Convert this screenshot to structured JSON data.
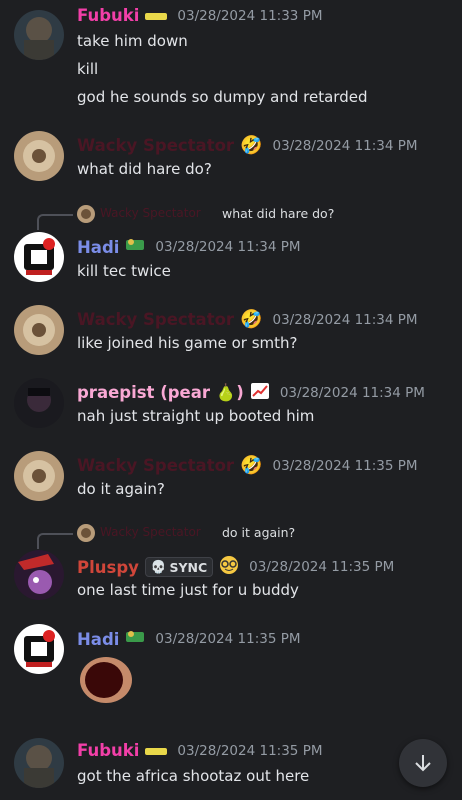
{
  "messages": [
    {
      "user": "Fubuki",
      "user_color": "#f23fa8",
      "timestamp": "03/28/2024 11:33 PM",
      "lines": [
        "take him down",
        "kill",
        "god he sounds so dumpy and retarded"
      ]
    },
    {
      "user": "Wacky Spectator",
      "user_color": "#4a1624",
      "timestamp": "03/28/2024 11:34 PM",
      "lines": [
        "what did hare do?"
      ]
    },
    {
      "reply_to_user": "Wacky Spectator",
      "reply_to_text": "what did hare do?",
      "user": "Hadi",
      "user_color": "#7b8de8",
      "timestamp": "03/28/2024 11:34 PM",
      "lines": [
        "kill tec twice"
      ]
    },
    {
      "user": "Wacky Spectator",
      "user_color": "#4a1624",
      "timestamp": "03/28/2024 11:34 PM",
      "lines": [
        "like joined his game or smth?"
      ]
    },
    {
      "user": "praepist (pear 🍐)",
      "user_color": "#f9a8d4",
      "timestamp": "03/28/2024 11:34 PM",
      "lines": [
        "nah just straight up booted him"
      ]
    },
    {
      "user": "Wacky Spectator",
      "user_color": "#4a1624",
      "timestamp": "03/28/2024 11:35 PM",
      "lines": [
        "do it again?"
      ]
    },
    {
      "reply_to_user": "Wacky Spectator",
      "reply_to_text": "do it again?",
      "user": "Pluspy",
      "user_color": "#d0463a",
      "tag": "SYNC",
      "timestamp": "03/28/2024 11:35 PM",
      "lines": [
        "one last time just for u buddy"
      ]
    },
    {
      "user": "Hadi",
      "user_color": "#7b8de8",
      "timestamp": "03/28/2024 11:35 PM",
      "lines": []
    },
    {
      "user": "Fubuki",
      "user_color": "#f23fa8",
      "timestamp": "03/28/2024 11:35 PM",
      "lines": [
        "got the africa shootaz out here"
      ]
    }
  ],
  "icons": {
    "reaction": "rofl-emoji",
    "scroll": "arrow-down-icon"
  }
}
